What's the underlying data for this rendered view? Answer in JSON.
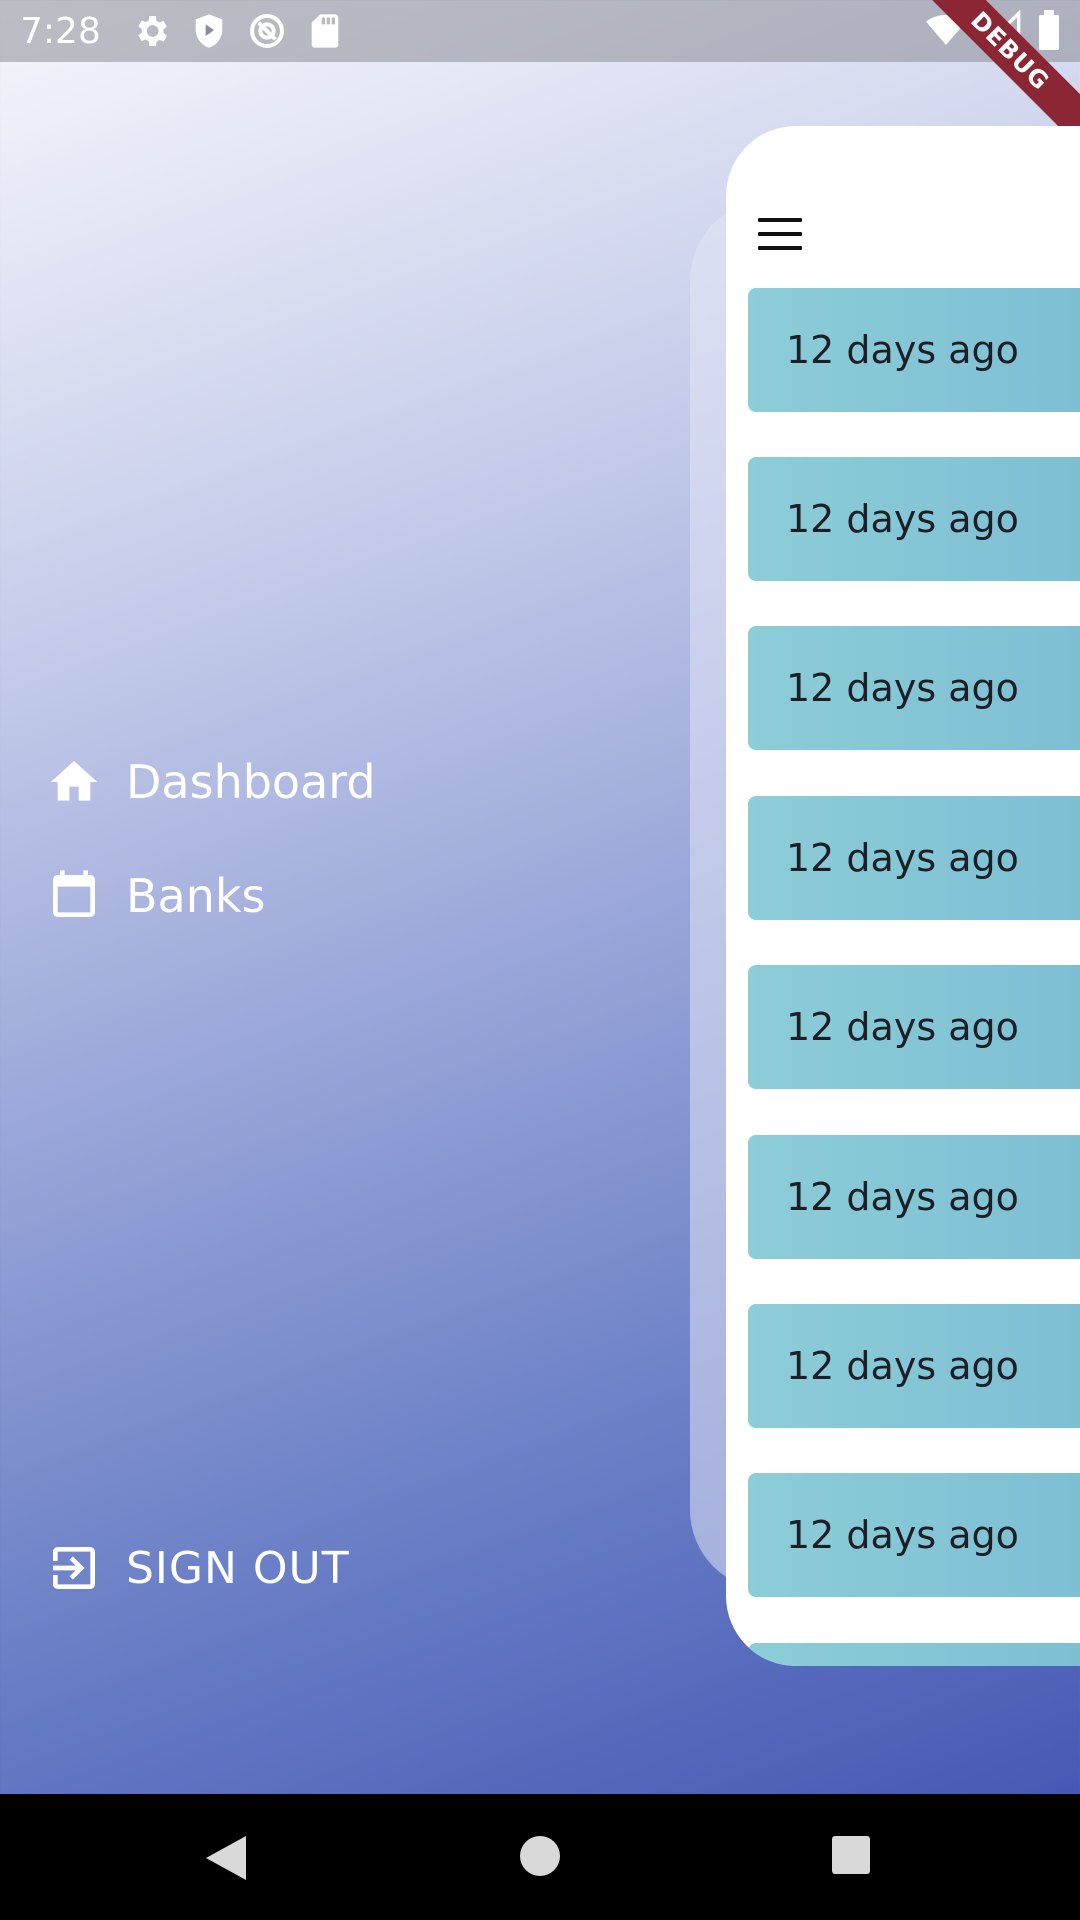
{
  "status_bar": {
    "time": "7:28",
    "left_icons": [
      "settings-icon",
      "shield-play-icon",
      "at-sign-icon",
      "sd-card-icon"
    ],
    "right_icons": [
      "wifi-icon",
      "cell-signal-icon",
      "battery-icon"
    ]
  },
  "debug_banner": {
    "label": "DEBUG"
  },
  "drawer": {
    "items": [
      {
        "label": "Dashboard",
        "icon": "home-icon"
      },
      {
        "label": "Banks",
        "icon": "calendar-icon"
      }
    ],
    "sign_out": {
      "label": "SIGN OUT",
      "icon": "sign-out-icon"
    }
  },
  "main": {
    "menu_icon": "hamburger-menu-icon",
    "list": [
      {
        "time": "12 days ago"
      },
      {
        "time": "12 days ago"
      },
      {
        "time": "12 days ago"
      },
      {
        "time": "12 days ago"
      },
      {
        "time": "12 days ago"
      },
      {
        "time": "12 days ago"
      },
      {
        "time": "12 days ago"
      },
      {
        "time": "12 days ago"
      }
    ]
  },
  "nav_bar": {
    "buttons": [
      "back-icon",
      "home-circle-icon",
      "recents-icon"
    ]
  }
}
